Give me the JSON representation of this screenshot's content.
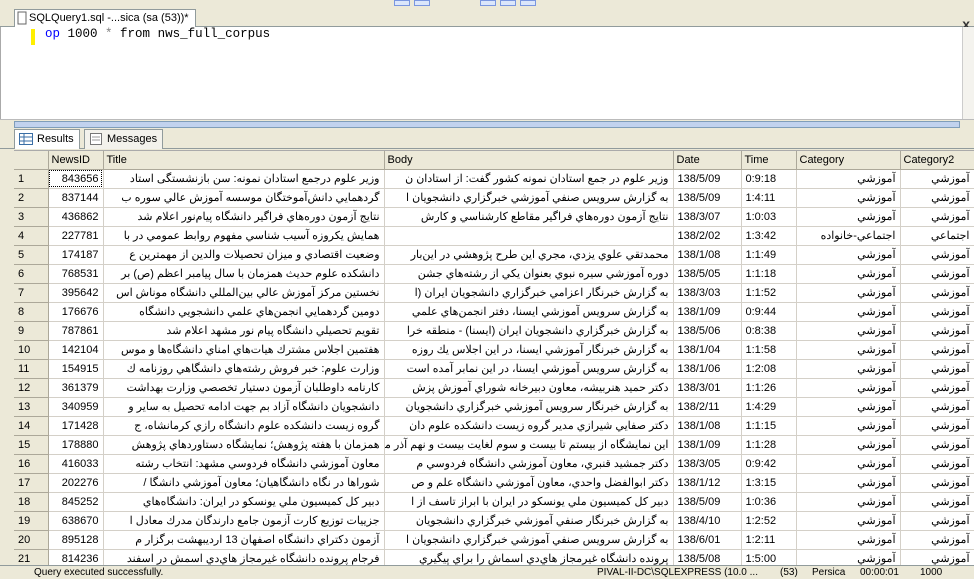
{
  "document_tab": {
    "label": "SQLQuery1.sql -...sica (sa (53))*",
    "close_glyph": "x"
  },
  "editor": {
    "query_parts": [
      "op",
      " 1000 ",
      "*",
      " from ",
      "nws_full_corpus"
    ]
  },
  "result_tabs": [
    {
      "label": "Results",
      "icon": "grid-icon"
    },
    {
      "label": "Messages",
      "icon": "messages-icon"
    }
  ],
  "grid": {
    "columns": [
      "",
      "NewsID",
      "Title",
      "Body",
      "Date",
      "Time",
      "Category",
      "Category2"
    ],
    "rows": [
      [
        "1",
        "843656",
        "وزیر علوم درجمع استادان نمونه: سن بازنشستگی استاد",
        "وزیر علوم در جمع استادان نمونه کشور گفت: از استادان ن",
        "138/5/09",
        "0:9:18",
        "آموزشي",
        "آموزشي"
      ],
      [
        "2",
        "837144",
        "گردهمايي دانش‌آموختگان موسسه آموزش عالي سوره ب",
        "به گزارش سرويس صنفي آموزشي خبرگزاري دانشجويان ا",
        "138/5/09",
        "1:4:11",
        "آموزشي",
        "آموزشي"
      ],
      [
        "3",
        "436862",
        "نتايج آزمون دوره‌هاي فراگير دانشگاه پيام‌نور اعلام شد",
        "نتايج آزمون دوره‌هاي فراگير مقاطع كارشناسي و كارش",
        "138/3/07",
        "1:0:03",
        "آموزشي",
        "آموزشي"
      ],
      [
        "4",
        "227781",
        "همايش يكروزه آسيب شناسي مفهوم روابط عمومي در با",
        "",
        "138/2/02",
        "1:3:42",
        "اجتماعي-خانواده",
        "اجتماعي"
      ],
      [
        "5",
        "174187",
        "وضعيت اقتصادي و ميزان تحصيلات والدين از مهمترين ع",
        "محمدتقي علوي يزدي، مجري اين طرح پژوهشي در اين‌بار",
        "138/1/08",
        "1:1:49",
        "آموزشي",
        "آموزشي"
      ],
      [
        "6",
        "768531",
        "دانشكده علوم حديث همزمان با سال پيامبر اعظم (ص) بر",
        "دوره آموزشي سيره نبوي بعنوان يكي از رشته‌هاي جشن",
        "138/5/05",
        "1:1:18",
        "آموزشي",
        "آموزشي"
      ],
      [
        "7",
        "395642",
        "نخستين مركز آموزش عالي بين‌المللي دانشگاه موناش اس",
        "به گزارش خبرنگار اعزامي خبرگزاري دانشجويان ايران (ا",
        "138/3/03",
        "1:1:52",
        "آموزشي",
        "آموزشي"
      ],
      [
        "8",
        "176676",
        "دومين گردهمايي انجمن‌هاي علمي دانشجويي دانشگاه",
        "به گزارش سرويس آموزشي ايسنا، دفتر انجمن‌هاي علمي",
        "138/1/09",
        "0:9:44",
        "آموزشي",
        "آموزشي"
      ],
      [
        "9",
        "787861",
        "تقويم تحصيلي دانشگاه پيام نور مشهد اعلام شد",
        "به گزارش خبرگزاري دانشجويان ايران (ايسنا) - منطقه خرا",
        "138/5/06",
        "0:8:38",
        "آموزشي",
        "آموزشي"
      ],
      [
        "10",
        "142104",
        "هفتمين اجلاس مشترك هيات‌هاي امناي دانشگاه‌ها و موس",
        "به گزارش خبرنگار آموزشي ايسنا، در اين اجلاس يك روزه",
        "138/1/04",
        "1:1:58",
        "آموزشي",
        "آموزشي"
      ],
      [
        "11",
        "154915",
        "وزارت علوم: خبر فروش رشته‌هاي دانشگاهي روزنامه ك",
        "به گزارش سرويس آموزشي ايسنا، در اين نمابر آمده است",
        "138/1/06",
        "1:2:08",
        "آموزشي",
        "آموزشي"
      ],
      [
        "12",
        "361379",
        "كارنامه داوطلبان آزمون دستيار تخصصي وزارت بهداشت",
        "دكتر حميد هنربيشه، معاون دبيرخانه شوراي آموزش پزش",
        "138/3/01",
        "1:1:26",
        "آموزشي",
        "آموزشي"
      ],
      [
        "13",
        "340959",
        "دانشجويان دانشگاه آزاد بم جهت ادامه تحصيل به ساير و",
        "به گزارش خبرنگار سرويس آموزشي خبرگزاري دانشجويان",
        "138/2/11",
        "1:4:29",
        "آموزشي",
        "آموزشي"
      ],
      [
        "14",
        "171428",
        "گروه زيست دانشكده علوم دانشگاه رازي كرمانشاه، ج",
        "دكتر صفايي شيرازي مدير گروه زيست دانشكده علوم دان",
        "138/1/08",
        "1:1:15",
        "آموزشي",
        "آموزشي"
      ],
      [
        "15",
        "178880",
        "همزمان با هفته پژوهش؛ نمايشگاه دستاوردهاي پژوهش",
        "اين نمايشگاه از بيستم تا بيست و سوم لغايت بيست و نهم آذر ماه",
        "138/1/09",
        "1:1:28",
        "آموزشي",
        "آموزشي"
      ],
      [
        "16",
        "416033",
        "معاون آموزشي دانشگاه فردوسي مشهد: انتخاب رشته",
        "دكتر جمشيد قنبري، معاون آموزشي دانشگاه فردوسي م",
        "138/3/05",
        "0:9:42",
        "آموزشي",
        "آموزشي"
      ],
      [
        "17",
        "202276",
        "شوراها در نگاه دانشگاهيان؛ معاون آموزشي دانشگا /",
        "دكتر ابوالفضل واحدي، معاون آموزشي دانشگاه علم و ص",
        "138/1/12",
        "1:3:15",
        "آموزشي",
        "آموزشي"
      ],
      [
        "18",
        "845252",
        "دبير كل كميسيون ملي يونسكو در ايران: دانشگاه‌هاي",
        "دبير كل كميسيون ملي يونسكو در ايران با ابراز تاسف از ا",
        "138/5/09",
        "1:0:36",
        "آموزشي",
        "آموزشي"
      ],
      [
        "19",
        "638670",
        "جزييات توزيع كارت آزمون جامع دارندگان مدرك معادل ا",
        "به گزارش خبرنگار صنفي آموزشي خبرگزاري دانشجويان",
        "138/4/10",
        "1:2:52",
        "آموزشي",
        "آموزشي"
      ],
      [
        "20",
        "895128",
        "آزمون دكتراي دانشگاه اصفهان 13 ارديبهشت برگزار م",
        "به گزارش سرويس صنفي آموزشي خبرگزاري دانشجويان ا",
        "138/6/01",
        "1:2:11",
        "آموزشي",
        "آموزشي"
      ],
      [
        "21",
        "814236",
        "فرجام پرونده دانشگاه غيرمجاز هاي‌دي اسمش در اسفند",
        "پرونده دانشگاه غيرمجاز هاي‌دي اسماش را براي پيگيري",
        "138/5/08",
        "1:5:00",
        "آموزشي",
        "آموزشي"
      ]
    ]
  },
  "statusbar": {
    "left": "Query executed successfully.",
    "server": "PIVAL-II-DC\\SQLEXPRESS (10.0 ...",
    "db": "(53)",
    "user": "Persica",
    "elapsed": "00:00:01",
    "rows": "1000"
  }
}
